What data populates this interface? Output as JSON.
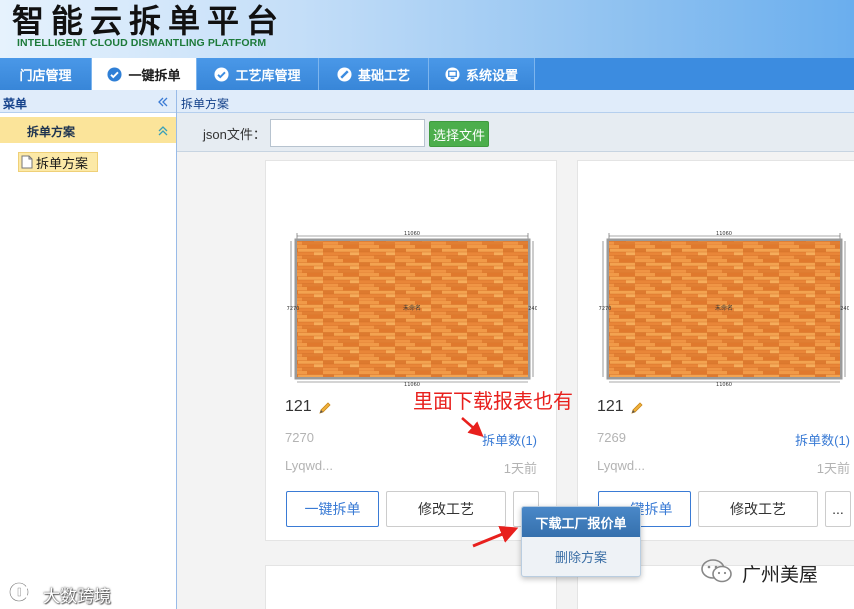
{
  "header": {
    "title": "智能云拆单平台",
    "subtitle": "INTELLIGENT CLOUD DISMANTLING PLATFORM"
  },
  "nav": {
    "tabs": [
      {
        "label": "门店管理"
      },
      {
        "label": "一键拆单",
        "icon": "check-circle-icon",
        "active": true
      },
      {
        "label": "工艺库管理",
        "icon": "check-circle-icon"
      },
      {
        "label": "基础工艺",
        "icon": "no-entry-icon"
      },
      {
        "label": "系统设置",
        "icon": "monitor-icon"
      }
    ]
  },
  "sidebar": {
    "title": "菜单",
    "title_icon": "double-chevron-left-icon",
    "section": {
      "label": "拆单方案",
      "icon": "double-chevron-up-icon"
    },
    "tree": [
      {
        "label": "拆单方案",
        "icon": "document-icon",
        "selected": true
      }
    ]
  },
  "breadcrumb": "拆单方案",
  "toolbar": {
    "json_label": "json文件：",
    "choose_button": "选择文件"
  },
  "cards": [
    {
      "name": "121",
      "name_icon": "pencil-icon",
      "code": "7270",
      "split_count": "拆单数(1)",
      "user": "Lyqwd...",
      "time": "1天前",
      "plan": {
        "top": "11060",
        "bottom": "11060",
        "left": "7270",
        "right": "240",
        "center": "未命名"
      },
      "buttons": {
        "split": "一键拆单",
        "modify": "修改工艺",
        "more": "..."
      }
    },
    {
      "name": "121",
      "name_icon": "pencil-icon",
      "code": "7269",
      "split_count": "拆单数(1)",
      "user": "Lyqwd...",
      "time": "1天前",
      "plan": {
        "top": "11060",
        "bottom": "11060",
        "left": "7270",
        "right": "240",
        "center": "未命名"
      },
      "buttons": {
        "split": "一键拆单",
        "modify": "修改工艺",
        "more": "..."
      }
    }
  ],
  "dropdown": {
    "items": [
      {
        "label": "下载工厂报价单",
        "highlighted": true
      },
      {
        "label": "删除方案"
      }
    ]
  },
  "annotation": {
    "text": "里面下载报表也有"
  },
  "watermarks": {
    "left": "大数跨境",
    "right": "广州美屋"
  },
  "colors": {
    "nav": "#3c8ce0",
    "accent": "#3a7bd5",
    "button_green": "#4cae4c",
    "annotation_red": "#e8201d",
    "highlight_yellow": "#fbe49a",
    "wood": "#ea8a3b"
  }
}
